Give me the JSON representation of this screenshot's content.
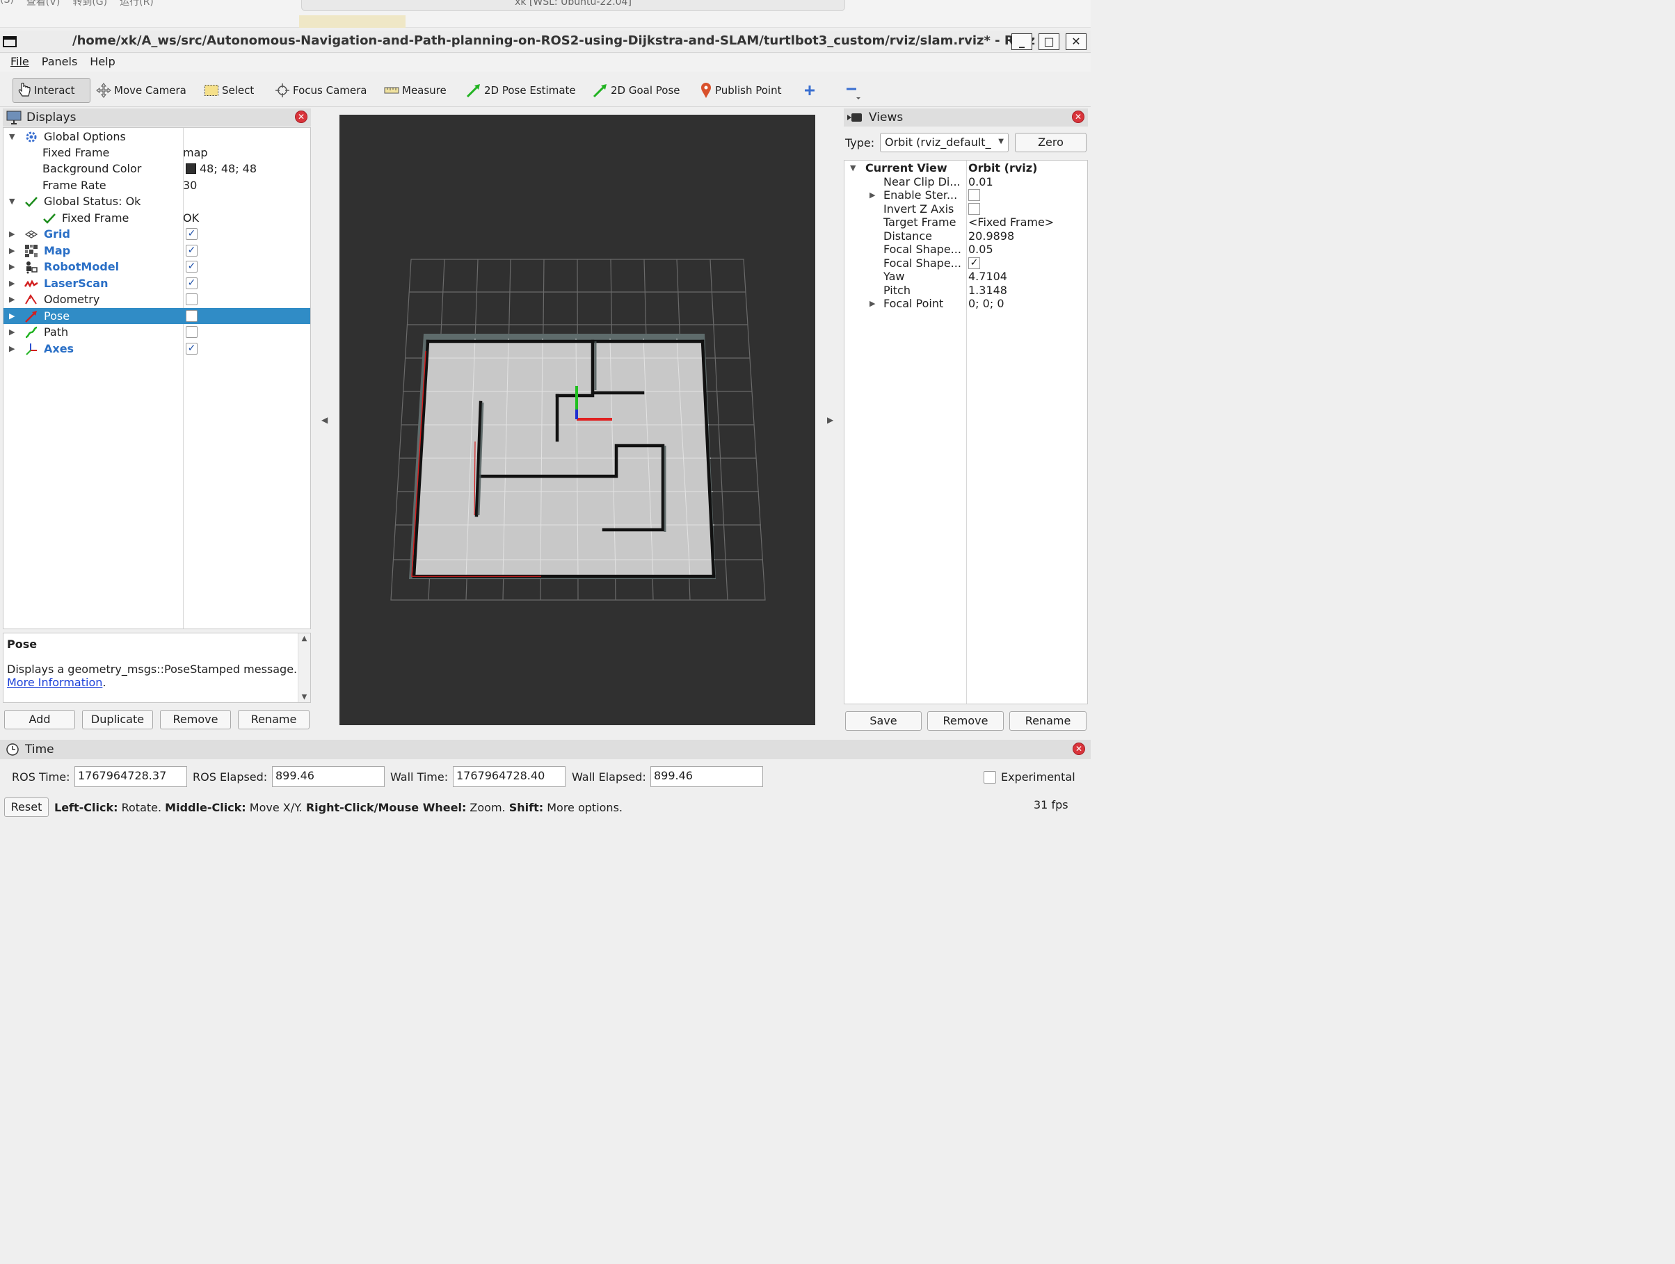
{
  "host": {
    "menu": [
      "￼(S)",
      "查看(V)",
      "转到(G)",
      "运行(R)",
      "···"
    ],
    "search": "xk [WSL: Ubuntu-22.04]"
  },
  "window": {
    "title": "/home/xk/A_ws/src/Autonomous-Navigation-and-Path-planning-on-ROS2-using-Dijkstra-and-SLAM/turtlbot3_custom/rviz/slam.rviz* - RViz",
    "minimize": "_",
    "maximize": "□",
    "close": "✕"
  },
  "menubar": {
    "file": "File",
    "panels": "Panels",
    "help": "Help"
  },
  "toolbar": {
    "interact": "Interact",
    "move_camera": "Move Camera",
    "select": "Select",
    "focus_camera": "Focus Camera",
    "measure": "Measure",
    "pose_estimate": "2D Pose Estimate",
    "goal_pose": "2D Goal Pose",
    "publish_point": "Publish Point"
  },
  "displays": {
    "title": "Displays",
    "global_options": "Global Options",
    "fixed_frame_label": "Fixed Frame",
    "fixed_frame_value": "map",
    "background_color_label": "Background Color",
    "background_color_value": "48; 48; 48",
    "background_color_swatch": "#303030",
    "frame_rate_label": "Frame Rate",
    "frame_rate_value": "30",
    "global_status": "Global Status: Ok",
    "status_fixed_frame": "Fixed Frame",
    "status_fixed_frame_value": "OK",
    "items": [
      {
        "label": "Grid",
        "checked": true,
        "icon": "grid-icon"
      },
      {
        "label": "Map",
        "checked": true,
        "icon": "map-icon"
      },
      {
        "label": "RobotModel",
        "checked": true,
        "icon": "robot-model-icon"
      },
      {
        "label": "LaserScan",
        "checked": true,
        "icon": "laser-scan-icon"
      },
      {
        "label": "Odometry",
        "checked": false,
        "icon": "odometry-icon"
      },
      {
        "label": "Pose",
        "checked": false,
        "icon": "pose-icon",
        "selected": true
      },
      {
        "label": "Path",
        "checked": false,
        "icon": "path-icon"
      },
      {
        "label": "Axes",
        "checked": true,
        "icon": "axes-icon"
      }
    ],
    "help_title": "Pose",
    "help_desc": "Displays a geometry_msgs::PoseStamped message.",
    "help_link": "More Information",
    "help_period": ".",
    "buttons": {
      "add": "Add",
      "duplicate": "Duplicate",
      "remove": "Remove",
      "rename": "Rename"
    }
  },
  "views": {
    "title": "Views",
    "type_label": "Type:",
    "type_value": "Orbit (rviz_default_",
    "zero": "Zero",
    "current_view": "Current View",
    "current_view_value": "Orbit (rviz)",
    "props": [
      {
        "name": "Near Clip Di...",
        "value": "0.01"
      },
      {
        "name": "Enable Ster...",
        "checkbox": false
      },
      {
        "name": "Invert Z Axis",
        "checkbox": false
      },
      {
        "name": "Target Frame",
        "value": "<Fixed Frame>"
      },
      {
        "name": "Distance",
        "value": "20.9898"
      },
      {
        "name": "Focal Shape...",
        "value": "0.05"
      },
      {
        "name": "Focal Shape...",
        "checkbox": true
      },
      {
        "name": "Yaw",
        "value": "4.7104"
      },
      {
        "name": "Pitch",
        "value": "1.3148"
      },
      {
        "name": "Focal Point",
        "value": "0; 0; 0"
      }
    ],
    "buttons": {
      "save": "Save",
      "remove": "Remove",
      "rename": "Rename"
    }
  },
  "time": {
    "title": "Time",
    "ros_time_label": "ROS Time:",
    "ros_time": "1767964728.37",
    "ros_elapsed_label": "ROS Elapsed:",
    "ros_elapsed": "899.46",
    "wall_time_label": "Wall Time:",
    "wall_time": "1767964728.40",
    "wall_elapsed_label": "Wall Elapsed:",
    "wall_elapsed": "899.46",
    "experimental": "Experimental",
    "reset": "Reset",
    "fps": "31 fps",
    "hints": [
      {
        "key": "Left-Click:",
        "text": " Rotate. "
      },
      {
        "key": "Middle-Click:",
        "text": " Move X/Y. "
      },
      {
        "key": "Right-Click/Mouse Wheel:",
        "text": " Zoom. "
      },
      {
        "key": "Shift:",
        "text": " More options."
      }
    ]
  },
  "colors": {
    "selection": "#308cc6",
    "link": "#1a3fd8",
    "close": "#d9343b",
    "viewport_bg": "#303030",
    "map_free": "#c8c8c8",
    "map_wall": "#111111",
    "axis_x": "#e02020",
    "axis_y": "#20c020"
  }
}
